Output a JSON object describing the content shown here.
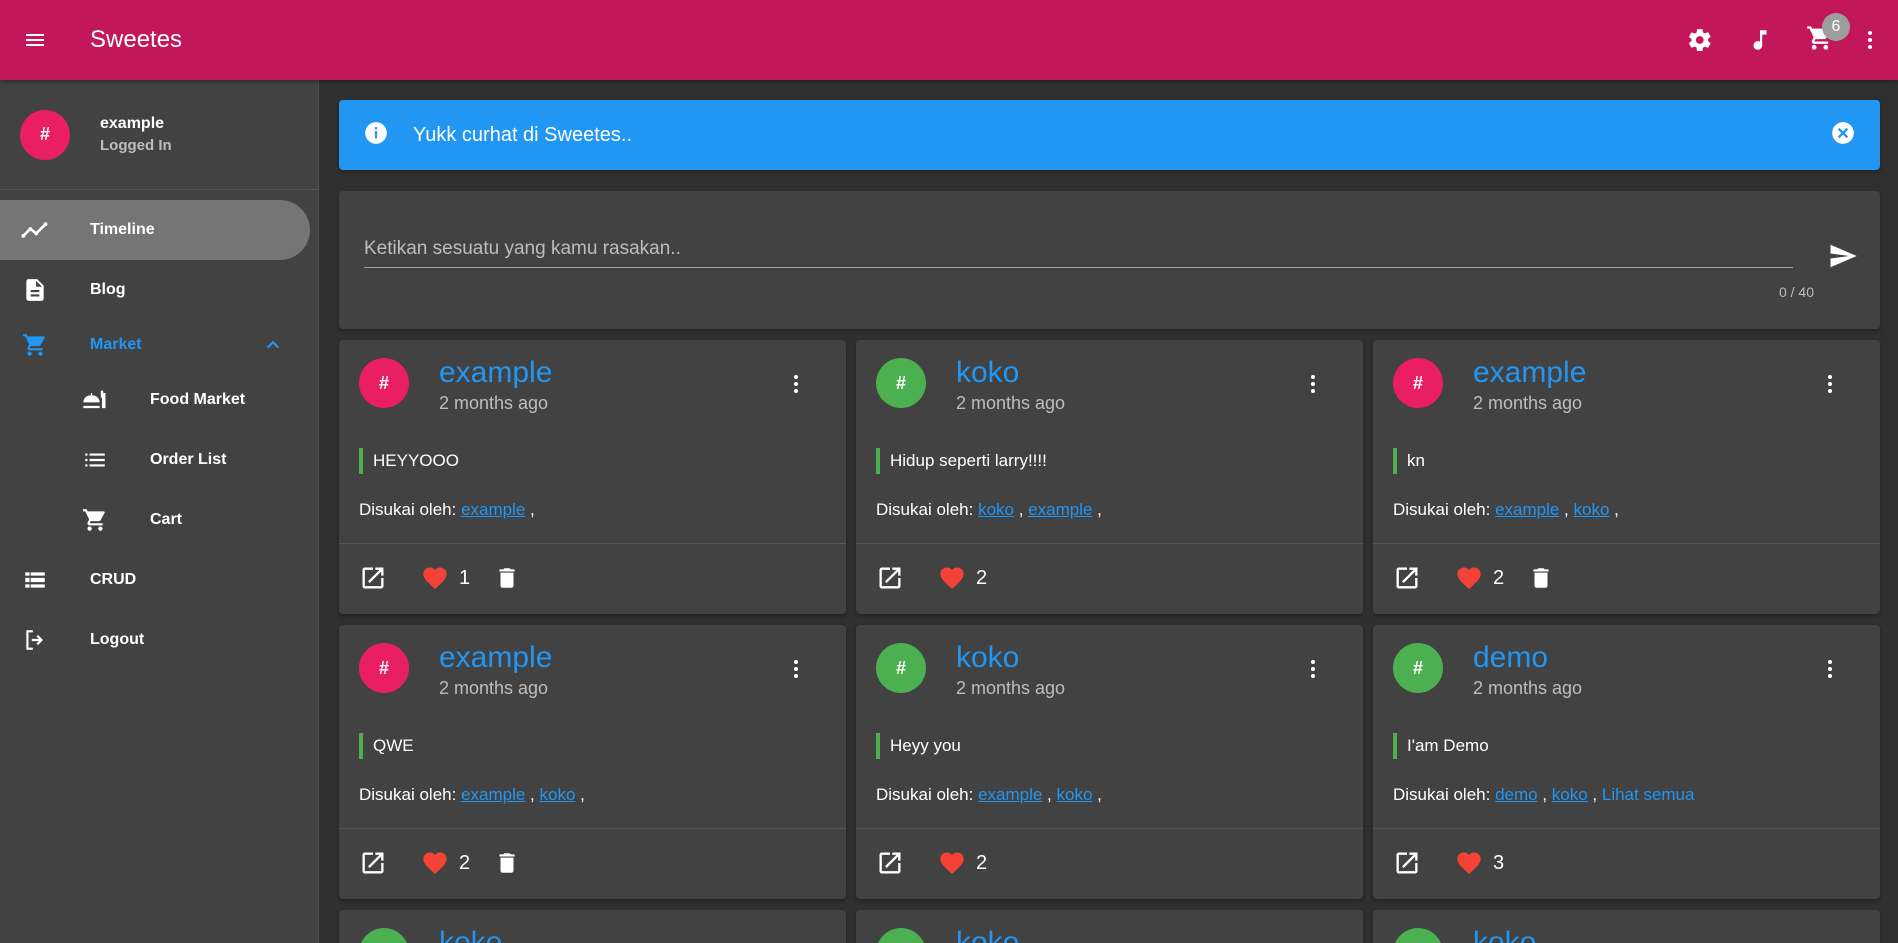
{
  "app": {
    "title": "Sweetes",
    "cart_count": "6"
  },
  "colors": {
    "appbar": "#c2185b",
    "accent": "#2196f3",
    "avatar_pink": "#e91e63",
    "avatar_green": "#4caf50",
    "heart": "#f44336"
  },
  "profile": {
    "initial": "#",
    "username": "example",
    "status": "Logged In"
  },
  "nav": {
    "timeline": "Timeline",
    "blog": "Blog",
    "market": "Market",
    "food_market": "Food Market",
    "order_list": "Order List",
    "cart": "Cart",
    "crud": "CRUD",
    "logout": "Logout"
  },
  "alert": {
    "text": "Yukk curhat di Sweetes.."
  },
  "composer": {
    "placeholder": "Ketikan sesuatu yang kamu rasakan..",
    "value": "",
    "counter": "0 / 40"
  },
  "likes_prefix": "Disukai oleh:",
  "posts": [
    {
      "initial": "#",
      "avatar": "pink",
      "user": "example",
      "time": "2 months ago",
      "text": "HEYYOOO",
      "liked_by": [
        "example"
      ],
      "see_all": "",
      "likes": "1",
      "deletable": true
    },
    {
      "initial": "#",
      "avatar": "green",
      "user": "koko",
      "time": "2 months ago",
      "text": "Hidup seperti larry!!!!",
      "liked_by": [
        "koko",
        "example"
      ],
      "see_all": "",
      "likes": "2",
      "deletable": false
    },
    {
      "initial": "#",
      "avatar": "pink",
      "user": "example",
      "time": "2 months ago",
      "text": "kn",
      "liked_by": [
        "example",
        "koko"
      ],
      "see_all": "",
      "likes": "2",
      "deletable": true
    },
    {
      "initial": "#",
      "avatar": "pink",
      "user": "example",
      "time": "2 months ago",
      "text": "QWE",
      "liked_by": [
        "example",
        "koko"
      ],
      "see_all": "",
      "likes": "2",
      "deletable": true
    },
    {
      "initial": "#",
      "avatar": "green",
      "user": "koko",
      "time": "2 months ago",
      "text": "Heyy you",
      "liked_by": [
        "example",
        "koko"
      ],
      "see_all": "",
      "likes": "2",
      "deletable": false
    },
    {
      "initial": "#",
      "avatar": "green",
      "user": "demo",
      "time": "2 months ago",
      "text": "I'am Demo",
      "liked_by": [
        "demo",
        "koko"
      ],
      "see_all": "Lihat semua",
      "likes": "3",
      "deletable": false
    }
  ],
  "partial_posts": [
    {
      "initial": "#",
      "avatar": "green",
      "user": "koko"
    },
    {
      "initial": "#",
      "avatar": "green",
      "user": "koko"
    },
    {
      "initial": "#",
      "avatar": "green",
      "user": "koko"
    }
  ]
}
